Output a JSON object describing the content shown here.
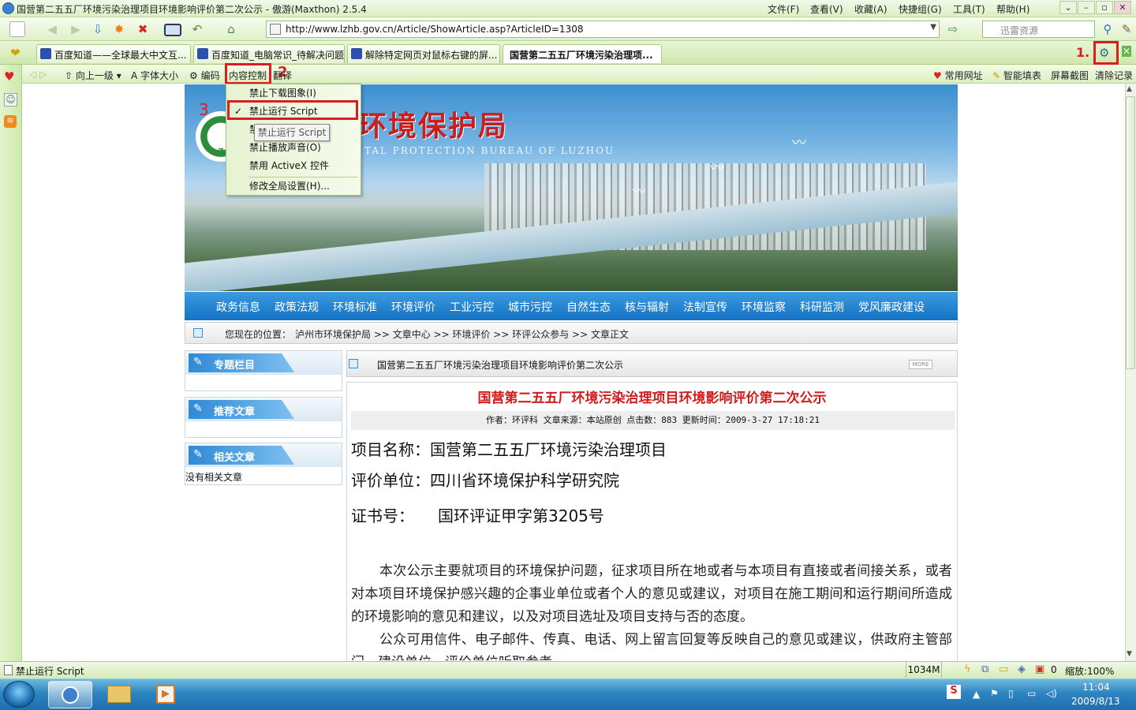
{
  "window": {
    "title": "国营第二五五厂环境污染治理项目环境影响评价第二次公示 - 傲游(Maxthon) 2.5.4",
    "menus": [
      "文件(F)",
      "查看(V)",
      "收藏(A)",
      "快捷组(G)",
      "工具(T)",
      "帮助(H)"
    ]
  },
  "toolbar": {
    "url": "http://www.lzhb.gov.cn/Article/ShowArticle.asp?ArticleID=1308",
    "search_placeholder": "迅雷资源"
  },
  "tabs": [
    {
      "label": "百度知道——全球最大中文互..."
    },
    {
      "label": "百度知道_电脑常识_待解决问题"
    },
    {
      "label": "解除特定网页对鼠标右键的屏..."
    },
    {
      "label": "国营第二五五厂环境污染治理项..."
    }
  ],
  "navbar": {
    "up_label": "向上一级",
    "font_label": "字体大小",
    "encoding_label": "编码",
    "content_control_label": "内容控制",
    "translate_label": "翻译",
    "right": [
      "常用网址",
      "智能填表",
      "屏幕截图",
      "清除记录"
    ]
  },
  "annotations": {
    "step1": "1.",
    "step2": "2",
    "step3": "3"
  },
  "dropdown": {
    "items": [
      "禁止下载图象(I)",
      "禁止运行 Script",
      "禁止运行 Java",
      "禁止播放声音(O)",
      "禁用 ActiveX 控件",
      "修改全局设置(H)..."
    ],
    "tooltip": "禁止运行 Script"
  },
  "page": {
    "bureau_name": "环境保护局",
    "bureau_en": "TAL PROTECTION BUREAU OF LUZHOU",
    "emblem_letter": "Z",
    "nav": [
      "政务信息",
      "政策法规",
      "环境标准",
      "环境评价",
      "工业污控",
      "城市污控",
      "自然生态",
      "核与辐射",
      "法制宣传",
      "环境监察",
      "科研监测",
      "党风廉政建设"
    ],
    "crumb_prefix": "您现在的位置：",
    "crumb": "泸州市环境保护局 >> 文章中心 >> 环境评价 >> 环评公众参与 >> 文章正文",
    "left_boxes": [
      {
        "title": "专题栏目",
        "body": ""
      },
      {
        "title": "推荐文章",
        "body": ""
      },
      {
        "title": "相关文章",
        "body": "没有相关文章"
      }
    ],
    "article_bar_title": "国营第二五五厂环境污染治理项目环境影响评价第二次公示",
    "more": "MORE",
    "article_title": "国营第二五五厂环境污染治理项目环境影响评价第二次公示",
    "meta": "作者：环评科 文章来源：本站原创 点击数：883 更新时间：2009-3-27 17:18:21",
    "lines": [
      {
        "label": "项目名称：",
        "value": "国营第二五五厂环境污染治理项目"
      },
      {
        "label": "评价单位：",
        "value": "四川省环境保护科学研究院"
      },
      {
        "label": "证书号：",
        "value": "国环评证甲字第3205号"
      }
    ],
    "para1": "本次公示主要就项目的环境保护问题，征求项目所在地或者与本项目有直接或者间接关系，或者对本项目环境保护感兴趣的企事业单位或者个人的意见或建议，对项目在施工期间和运行期间所造成的环境影响的意见和建议，以及对项目选址及项目支持与否的态度。",
    "para2": "公众可用信件、电子邮件、传真、电话、网上留言回复等反映自己的意见或建议，供政府主管部门、建设单位、评价单位听取参考。"
  },
  "status": {
    "left": "禁止运行 Script",
    "memory": "1034M",
    "count": "0",
    "zoom": "缩放:100%"
  },
  "taskbar": {
    "time": "11:04",
    "date": "2009/8/13"
  },
  "colors": {
    "annotation_red": "#d81f1f",
    "title_red": "#d01c1c",
    "nav_blue": "#1672c4"
  }
}
